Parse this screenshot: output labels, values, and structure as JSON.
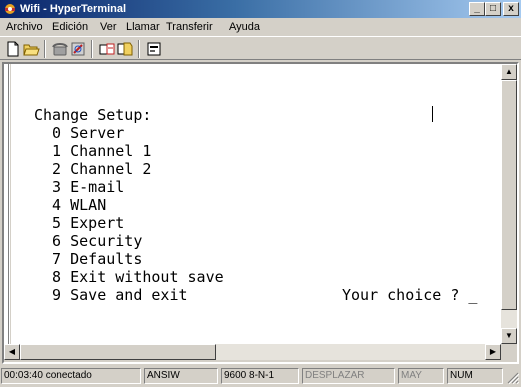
{
  "window": {
    "title": "Wifi - HyperTerminal",
    "minimize": "_",
    "maximize": "□",
    "close": "x"
  },
  "menu": [
    "Archivo",
    "Edición",
    "Ver",
    "Llamar",
    "Transferir",
    "Ayuda"
  ],
  "toolbar": {
    "icons": [
      "new-file-icon",
      "open-folder-icon",
      "phone-icon",
      "hang-up-icon",
      "send-icon",
      "receive-icon",
      "properties-icon"
    ]
  },
  "terminal": {
    "lines": [
      "Change Setup:",
      "  0 Server",
      "  1 Channel 1",
      "  2 Channel 2",
      "  3 E-mail",
      "  4 WLAN",
      "  5 Expert",
      "  6 Security",
      "  7 Defaults",
      "  8 Exit without save",
      "  9 Save and exit"
    ],
    "prompt": "Your choice ? _"
  },
  "statusbar": {
    "time": "00:03:40 conectado",
    "emulation": "ANSIW",
    "settings": "9600 8-N-1",
    "scroll": "DESPLAZAR",
    "caps": "MAY",
    "num": "NUM"
  },
  "colors": {
    "titlebar_start": "#0a246a",
    "titlebar_end": "#a6caf0",
    "face": "#d4d0c8"
  }
}
